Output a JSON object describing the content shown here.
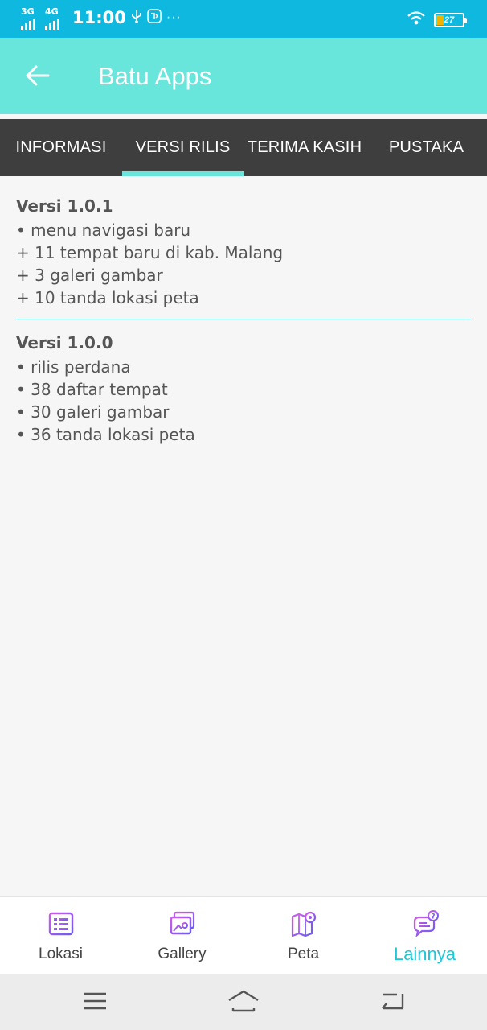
{
  "status_bar": {
    "network1": "3G",
    "network2": "4G",
    "time": "11:00",
    "usb_icon": "usb-icon",
    "app_icon": "notification-app-icon",
    "more": "···",
    "battery_level": "27",
    "battery_fraction": 0.27,
    "battery_color": "#f0b400"
  },
  "app_bar": {
    "title": "Batu Apps",
    "back_icon": "arrow-left-icon",
    "color": "#69e6dc"
  },
  "tabs": [
    {
      "label": "INFORMASI",
      "active": false
    },
    {
      "label": "VERSI RILIS",
      "active": true
    },
    {
      "label": "TERIMA KASIH",
      "active": false
    },
    {
      "label": "PUSTAKA",
      "active": false
    }
  ],
  "releases": [
    {
      "title": "Versi 1.0.1",
      "items": [
        "• menu navigasi baru",
        "+ 11 tempat baru di kab. Malang",
        "+ 3 galeri gambar",
        "+ 10 tanda lokasi peta"
      ]
    },
    {
      "title": "Versi 1.0.0",
      "items": [
        "• rilis perdana",
        "• 38 daftar tempat",
        "• 30 galeri gambar",
        "• 36 tanda lokasi peta"
      ]
    }
  ],
  "bottom_nav": [
    {
      "label": "Lokasi",
      "icon": "list-icon",
      "active": false
    },
    {
      "label": "Gallery",
      "icon": "gallery-icon",
      "active": false
    },
    {
      "label": "Peta",
      "icon": "map-icon",
      "active": false
    },
    {
      "label": "Lainnya",
      "icon": "help-chat-icon",
      "active": true
    }
  ],
  "system_nav": {
    "menu_icon": "menu-icon",
    "home_icon": "home-icon",
    "back_icon": "back-icon"
  },
  "colors": {
    "status_bar": "#0eb8de",
    "accent": "#69e6dc",
    "tab_bar": "#3e3e3e",
    "active_nav": "#1ec6d8",
    "icon_purple": "#8a5cf0",
    "divider": "#5fc6dc"
  }
}
